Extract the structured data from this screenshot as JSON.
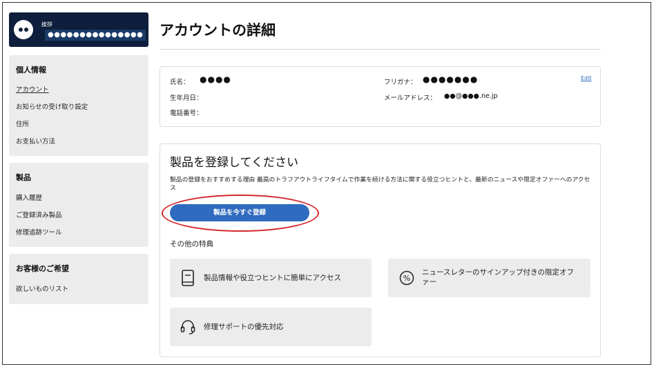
{
  "sidebar": {
    "greeting_label": "挨拶",
    "user_name": "●●●●●●●●●●●●●●●",
    "sections": [
      {
        "title": "個人情報",
        "items": [
          {
            "label": "アカウント",
            "active": true
          },
          {
            "label": "お知らせの受け取り設定",
            "active": false
          },
          {
            "label": "住所",
            "active": false
          },
          {
            "label": "お支払い方法",
            "active": false
          }
        ]
      },
      {
        "title": "製品",
        "items": [
          {
            "label": "購入履歴"
          },
          {
            "label": "ご登録済み製品"
          },
          {
            "label": "修理追跡ツール"
          }
        ]
      },
      {
        "title": "お客様のご希望",
        "items": [
          {
            "label": "欲しいものリスト"
          }
        ]
      }
    ]
  },
  "main": {
    "title": "アカウントの詳細",
    "account_info": {
      "name_label": "氏名：",
      "name_value": "●●●●",
      "birthdate_label": "生年月日：",
      "phone_label": "電話番号：",
      "furigana_label": "フリガナ：",
      "furigana_value": "●●●●●●●",
      "email_label": "メールアドレス：",
      "email_value": "●●@●●●.ne.jp",
      "edit_label": "Edit"
    },
    "register": {
      "title": "製品を登録してください",
      "description": "製品の登録をおすすめする理由 最高のトラフアウトライフタイムで作業を続ける方法に関する役立つヒントと、最新のニュースや限定オファーへのアクセス",
      "button_label": "製品を今すぐ登録",
      "benefits_title": "その他の特典",
      "benefits": [
        {
          "icon": "book-icon",
          "text": "製品情報や役立つヒントに簡単にアクセス"
        },
        {
          "icon": "percent-icon",
          "text": "ニュースレターのサインアップ付きの限定オファー"
        },
        {
          "icon": "headset-icon",
          "text": "修理サポートの優先対応"
        }
      ]
    }
  },
  "colors": {
    "greeting_bg": "#0e1f3d",
    "button_bg": "#2f6bbf",
    "highlight": "#d4262b",
    "panel_bg": "#ececec",
    "link": "#2a6bc4"
  }
}
